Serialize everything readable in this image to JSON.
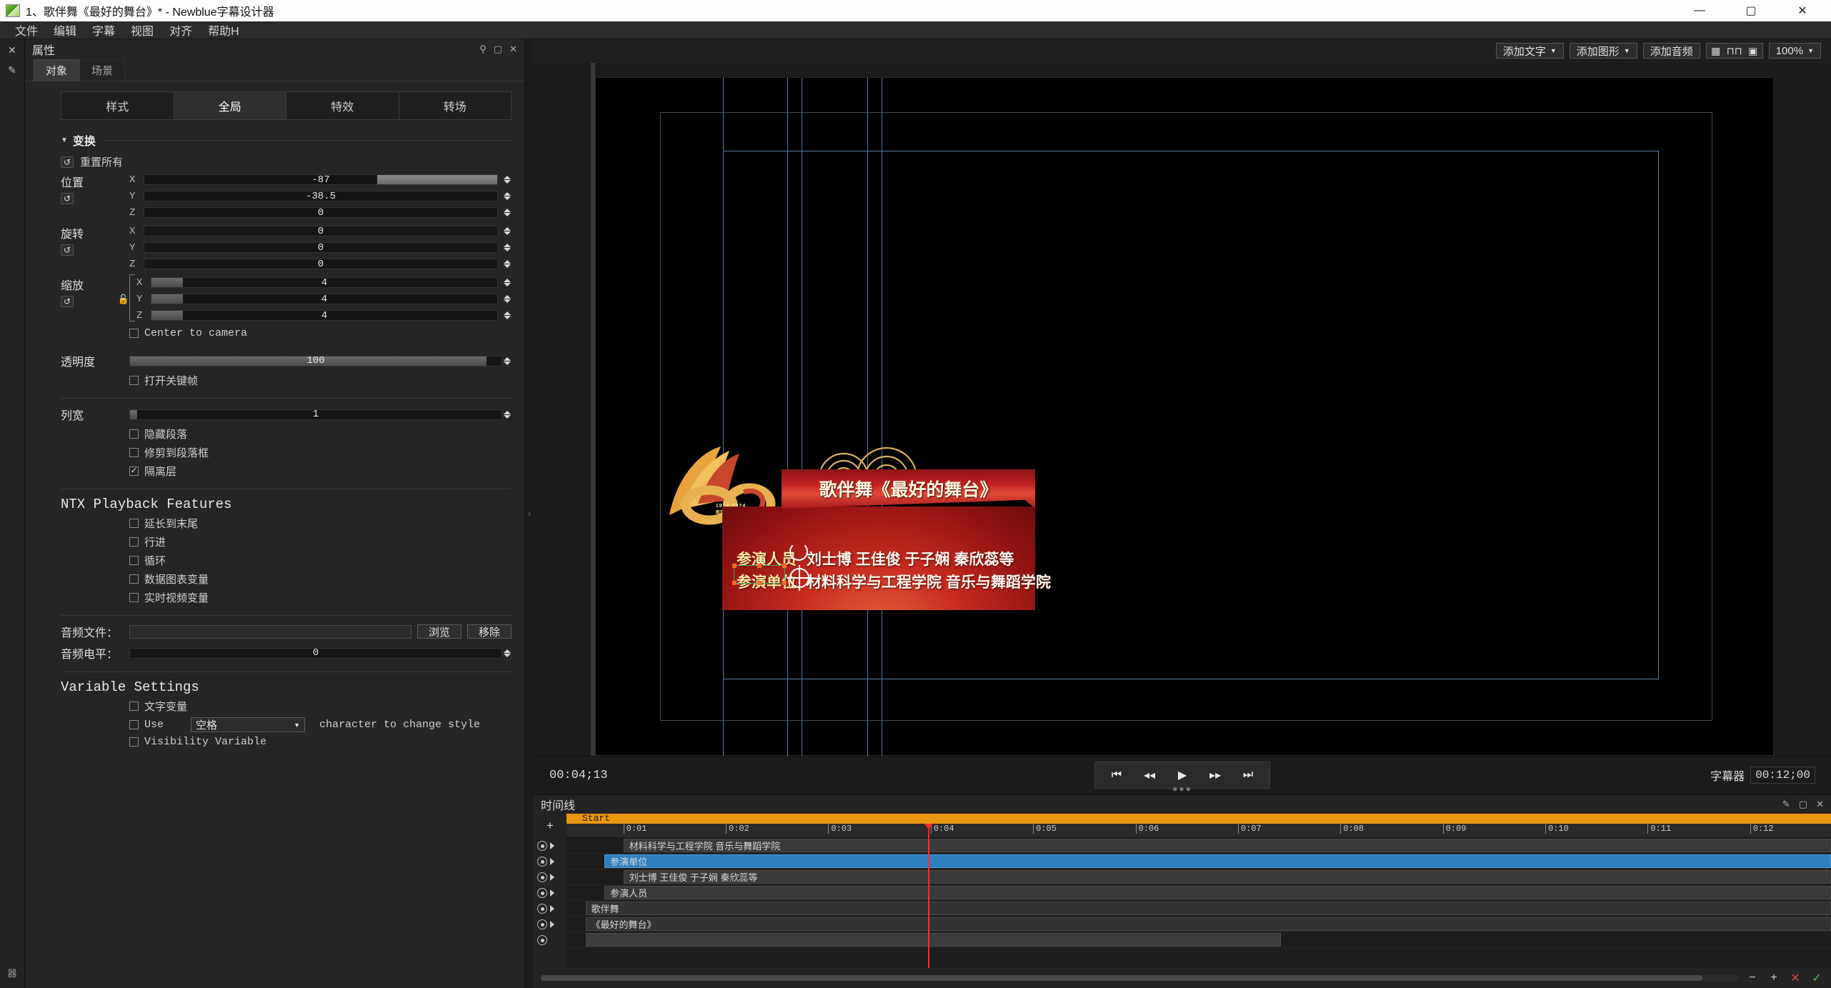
{
  "window": {
    "title": "1、歌伴舞《最好的舞台》* - Newblue字幕设计器",
    "minimize": "—",
    "maximize": "▢",
    "close": "✕"
  },
  "menubar": {
    "items": [
      "文件",
      "编辑",
      "字幕",
      "视图",
      "对齐",
      "帮助H"
    ]
  },
  "rail": {
    "close_icon": "✕",
    "pin_icon": "✎",
    "expand_icon": "›",
    "vertical_label": "器"
  },
  "properties": {
    "panel_title": "属性",
    "header_icons": {
      "pin": "⚲",
      "float": "▢",
      "close": "✕"
    },
    "tabs": [
      {
        "label": "对象",
        "active": true
      },
      {
        "label": "场景",
        "active": false
      }
    ],
    "segments": [
      {
        "label": "样式",
        "active": false
      },
      {
        "label": "全局",
        "active": true
      },
      {
        "label": "特效",
        "active": false
      },
      {
        "label": "转场",
        "active": false
      }
    ],
    "transform": {
      "section_label": "变换",
      "reset_all_label": "重置所有",
      "position": {
        "label": "位置",
        "x": "-87",
        "y": "-38.5",
        "z": "0"
      },
      "rotation": {
        "label": "旋转",
        "x": "0",
        "y": "0",
        "z": "0"
      },
      "scale": {
        "label": "缩放",
        "x": "4",
        "y": "4",
        "z": "4"
      },
      "center_to_camera": {
        "label": "Center to camera",
        "checked": false
      }
    },
    "opacity": {
      "label": "透明度",
      "value": "100",
      "keyframe": {
        "label": "打开关键帧",
        "checked": false
      }
    },
    "column": {
      "label": "列宽",
      "value": "1",
      "options": [
        {
          "label": "隐藏段落",
          "checked": false
        },
        {
          "label": "修剪到段落框",
          "checked": false
        },
        {
          "label": "隔离层",
          "checked": true
        }
      ]
    },
    "ntx": {
      "title": "NTX Playback Features",
      "options": [
        {
          "label": "延长到末尾",
          "checked": false
        },
        {
          "label": "行进",
          "checked": false
        },
        {
          "label": "循环",
          "checked": false
        },
        {
          "label": "数据图表变量",
          "checked": false
        },
        {
          "label": "实时视频变量",
          "checked": false
        }
      ]
    },
    "audio": {
      "file_label": "音频文件：",
      "file_value": "",
      "browse_label": "浏览",
      "remove_label": "移除",
      "level_label": "音频电平：",
      "level_value": "0"
    },
    "variables": {
      "title": "Variable Settings",
      "text_variable": {
        "label": "文字变量",
        "checked": false
      },
      "use": {
        "label": "Use",
        "checked": false,
        "select_value": "空格",
        "suffix": "character to change style"
      },
      "visibility": {
        "label": "Visibility Variable",
        "checked": false
      }
    }
  },
  "canvas_toolbar": {
    "add_text": "添加文字",
    "add_shape": "添加图形",
    "add_audio": "添加音频",
    "icons": [
      "grid-icon",
      "wave-icon",
      "frame-icon"
    ],
    "zoom": "100%",
    "caret": "▾"
  },
  "stage": {
    "graphic": {
      "emblem_years": "1974-2024",
      "emblem_sub": "南京大学50周年",
      "ribbon_title": "歌伴舞《最好的舞台》",
      "rows": [
        {
          "key": "参演人员",
          "value": "刘士博 王佳俊 于子娴 秦欣蕊等"
        },
        {
          "key": "参演单位",
          "value": "材料科学与工程学院 音乐与舞蹈学院"
        }
      ]
    }
  },
  "transport": {
    "current_time": "00:04;13",
    "buttons": [
      "⏮",
      "◂◂",
      "▶",
      "▸▸",
      "⏭"
    ],
    "right_label": "字幕器",
    "duration": "00:12;00"
  },
  "timeline": {
    "title": "时间线",
    "header_icons": [
      "wrench-icon",
      "float-icon",
      "close-icon"
    ],
    "start_label": "Start",
    "add_label": "+",
    "ticks": [
      "0:01",
      "0:02",
      "0:03",
      "0:04",
      "0:05",
      "0:06",
      "0:07",
      "0:08",
      "0:09",
      "0:10",
      "0:11",
      "0:12"
    ],
    "layers": [
      {
        "name": "材料科学与工程学院  音乐与舞蹈学院",
        "selected": false,
        "left_pct": 4.5,
        "width_pct": 95.5,
        "label_indent": 22
      },
      {
        "name": "参演单位",
        "selected": true,
        "left_pct": 3.0,
        "width_pct": 97.0,
        "label_indent": 5
      },
      {
        "name": "刘士博 王佳俊 于子娴 秦欣蕊等",
        "selected": false,
        "left_pct": 4.5,
        "width_pct": 95.5,
        "label_indent": 22
      },
      {
        "name": "参演人员",
        "selected": false,
        "left_pct": 3.0,
        "width_pct": 97.0,
        "label_indent": 10
      },
      {
        "name": "歌伴舞",
        "selected": false,
        "left_pct": 1.5,
        "width_pct": 98.5,
        "label_indent": 6
      },
      {
        "name": "《最好的舞台》",
        "selected": false,
        "left_pct": 1.5,
        "width_pct": 98.5,
        "label_indent": 6
      }
    ],
    "footer_buttons": [
      "−",
      "+",
      "✕",
      "✓"
    ]
  },
  "colors": {
    "accent_orange": "#e8960e",
    "selection_blue": "#2f7fbf",
    "playhead_red": "#ff2b2b",
    "panel_bg": "#252525"
  }
}
